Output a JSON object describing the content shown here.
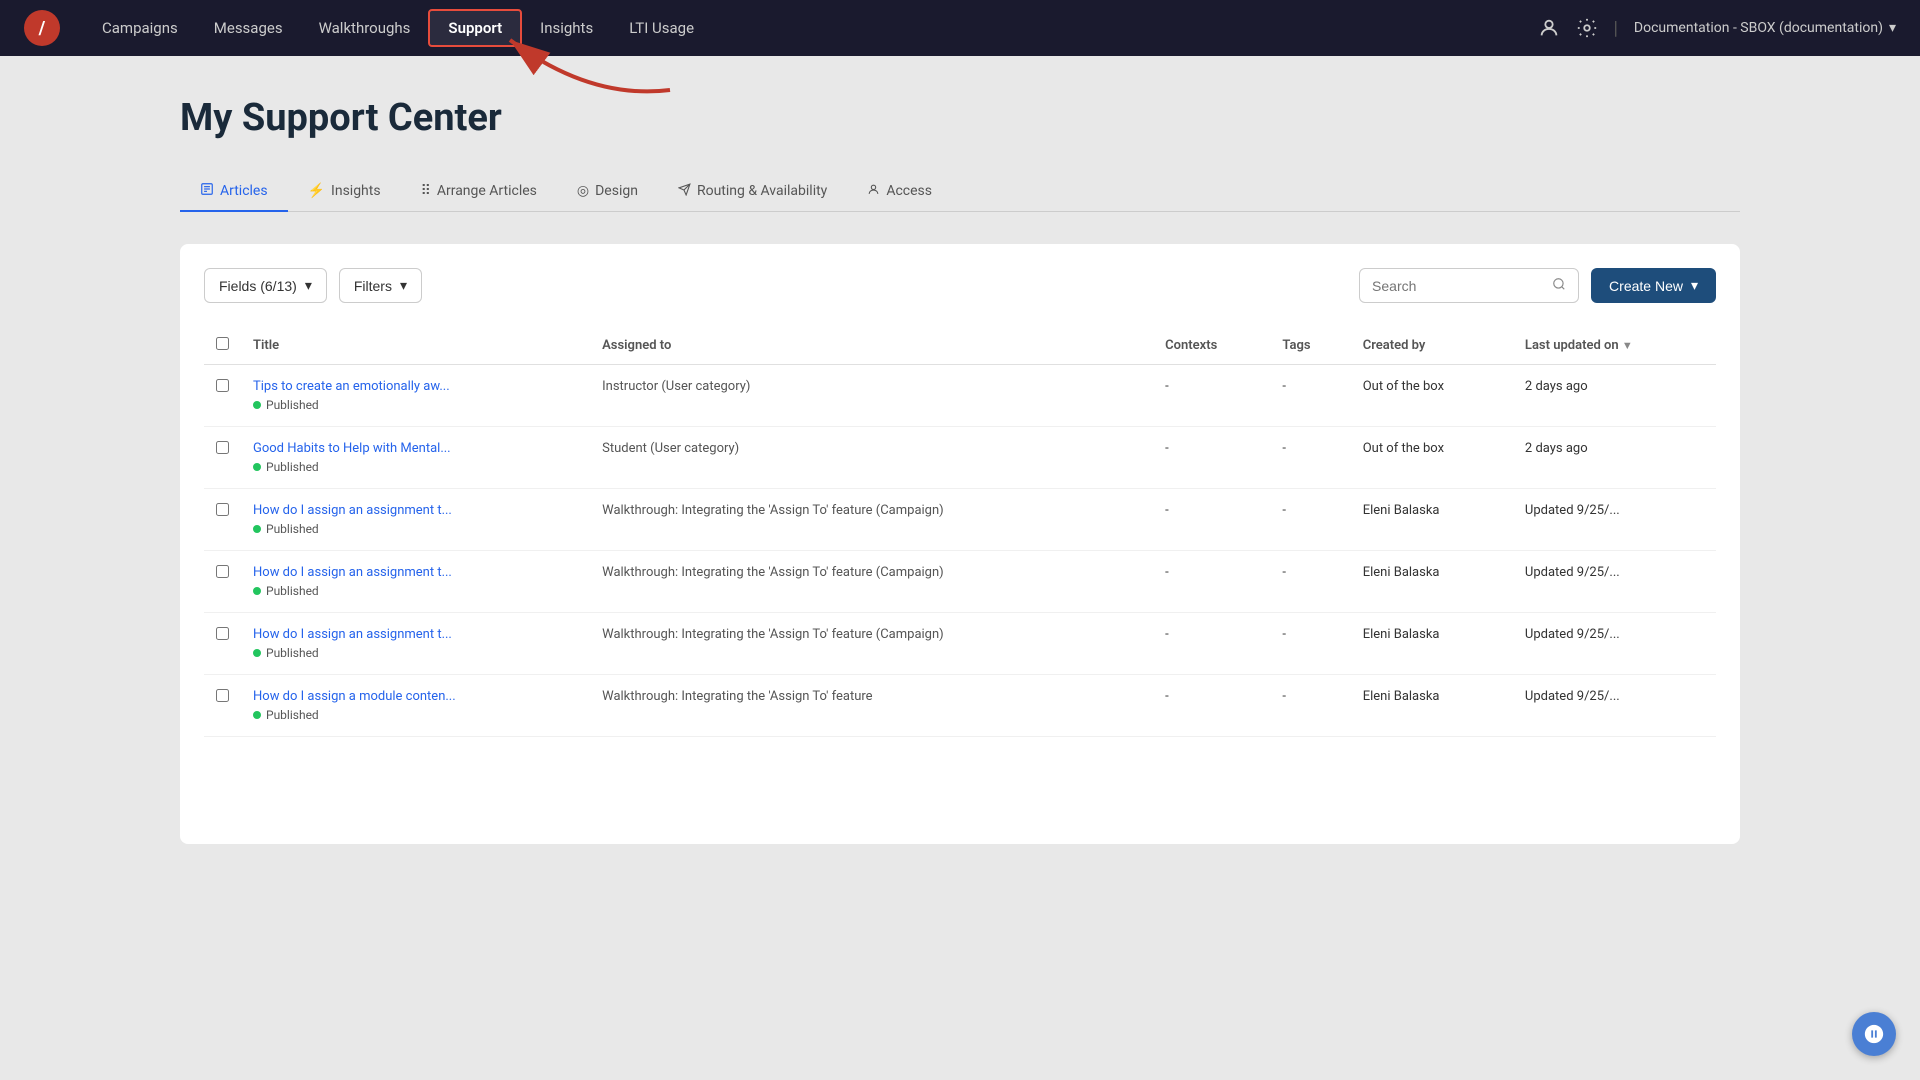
{
  "nav": {
    "links": [
      {
        "label": "Campaigns",
        "active": false
      },
      {
        "label": "Messages",
        "active": false
      },
      {
        "label": "Walkthroughs",
        "active": false
      },
      {
        "label": "Support",
        "active": true
      },
      {
        "label": "Insights",
        "active": false
      },
      {
        "label": "LTI Usage",
        "active": false
      }
    ],
    "workspace": "Documentation - SBOX (documentation)",
    "chevron": "▾"
  },
  "page": {
    "title": "My Support Center"
  },
  "subTabs": [
    {
      "icon": "📄",
      "label": "Articles",
      "active": true
    },
    {
      "icon": "⚡",
      "label": "Insights",
      "active": false
    },
    {
      "icon": "⠿",
      "label": "Arrange Articles",
      "active": false
    },
    {
      "icon": "◎",
      "label": "Design",
      "active": false
    },
    {
      "icon": "✈",
      "label": "Routing & Availability",
      "active": false
    },
    {
      "icon": "👤",
      "label": "Access",
      "active": false
    }
  ],
  "toolbar": {
    "fieldsLabel": "Fields (6/13)",
    "filtersLabel": "Filters",
    "searchPlaceholder": "Search",
    "createNewLabel": "Create New"
  },
  "table": {
    "columns": [
      {
        "label": "Title"
      },
      {
        "label": "Assigned to"
      },
      {
        "label": "Contexts"
      },
      {
        "label": "Tags"
      },
      {
        "label": "Created by"
      },
      {
        "label": "Last updated on",
        "sortable": true
      }
    ],
    "rows": [
      {
        "title": "Tips to create an emotionally aw...",
        "status": "Published",
        "assignedTo": "Instructor (User category)",
        "contexts": "-",
        "tags": "-",
        "createdBy": "Out of the box",
        "lastUpdated": "2 days ago"
      },
      {
        "title": "Good Habits to Help with Mental...",
        "status": "Published",
        "assignedTo": "Student (User category)",
        "contexts": "-",
        "tags": "-",
        "createdBy": "Out of the box",
        "lastUpdated": "2 days ago"
      },
      {
        "title": "How do I assign an assignment t...",
        "status": "Published",
        "assignedTo": "Walkthrough: Integrating the 'Assign To' feature (Campaign)",
        "contexts": "-",
        "tags": "-",
        "createdBy": "Eleni Balaska",
        "lastUpdated": "Updated 9/25/..."
      },
      {
        "title": "How do I assign an assignment t...",
        "status": "Published",
        "assignedTo": "Walkthrough: Integrating the 'Assign To' feature (Campaign)",
        "contexts": "-",
        "tags": "-",
        "createdBy": "Eleni Balaska",
        "lastUpdated": "Updated 9/25/..."
      },
      {
        "title": "How do I assign an assignment t...",
        "status": "Published",
        "assignedTo": "Walkthrough: Integrating the 'Assign To' feature (Campaign)",
        "contexts": "-",
        "tags": "-",
        "createdBy": "Eleni Balaska",
        "lastUpdated": "Updated 9/25/..."
      },
      {
        "title": "How do I assign a module conten...",
        "status": "Published",
        "assignedTo": "Walkthrough: Integrating the 'Assign To' feature",
        "contexts": "-",
        "tags": "-",
        "createdBy": "Eleni Balaska",
        "lastUpdated": "Updated 9/25/..."
      }
    ]
  }
}
